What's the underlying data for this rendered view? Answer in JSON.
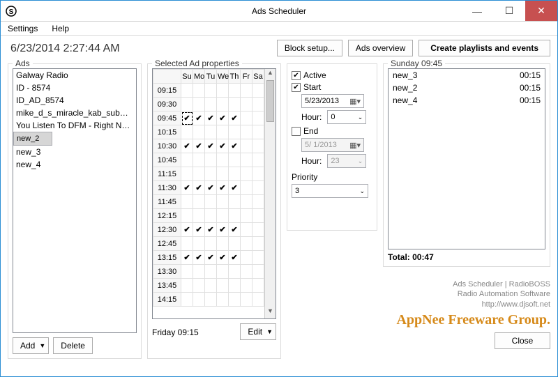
{
  "window": {
    "title": "Ads Scheduler"
  },
  "menu": {
    "settings": "Settings",
    "help": "Help"
  },
  "datetime": "6/23/2014 2:27:44 AM",
  "buttons": {
    "block_setup": "Block setup...",
    "ads_overview": "Ads overview",
    "create_playlists": "Create playlists and events",
    "add": "Add",
    "delete": "Delete",
    "edit": "Edit",
    "close": "Close"
  },
  "panels": {
    "ads": "Ads",
    "selected": "Selected Ad properties",
    "playlist_header": "Sunday 09:45",
    "status_left": "Friday 09:15"
  },
  "ads_list": [
    "Galway Radio",
    "ID - 8574",
    "ID_AD_8574",
    "mike_d_s_miracle_kab_submiss...",
    "You Listen To DFM - Right Now!",
    "new_2",
    "new_3",
    "new_4"
  ],
  "ads_selected_index": 5,
  "days": [
    "Su",
    "Mo",
    "Tu",
    "We",
    "Th",
    "Fr",
    "Sa"
  ],
  "times": [
    "09:15",
    "09:30",
    "09:45",
    "10:15",
    "10:30",
    "10:45",
    "11:15",
    "11:30",
    "11:45",
    "12:15",
    "12:30",
    "12:45",
    "13:15",
    "13:30",
    "13:45",
    "14:15"
  ],
  "focused_cell": {
    "time": "09:45",
    "day": "Su"
  },
  "checks": {
    "09:45": [
      "Su",
      "Mo",
      "Tu",
      "We",
      "Th"
    ],
    "10:30": [
      "Su",
      "Mo",
      "Tu",
      "We",
      "Th"
    ],
    "11:30": [
      "Su",
      "Mo",
      "Tu",
      "We",
      "Th"
    ],
    "12:30": [
      "Su",
      "Mo",
      "Tu",
      "We",
      "Th"
    ],
    "13:15": [
      "Su",
      "Mo",
      "Tu",
      "We",
      "Th"
    ]
  },
  "props": {
    "active_label": "Active",
    "active_checked": true,
    "start_label": "Start",
    "start_checked": true,
    "start_date": "5/23/2013",
    "hour_label": "Hour:",
    "start_hour": "0",
    "end_label": "End",
    "end_checked": false,
    "end_date": "5/ 1/2013",
    "end_hour": "23",
    "priority_label": "Priority",
    "priority_value": "3"
  },
  "playlist_items": [
    {
      "name": "new_3",
      "dur": "00:15"
    },
    {
      "name": "new_2",
      "dur": "00:15"
    },
    {
      "name": "new_4",
      "dur": "00:15"
    }
  ],
  "total_label": "Total: 00:47",
  "credits": {
    "line1": "Ads Scheduler | RadioBOSS",
    "line2": "Radio Automation Software",
    "line3": "http://www.djsoft.net"
  },
  "watermark": "AppNee Freeware Group."
}
